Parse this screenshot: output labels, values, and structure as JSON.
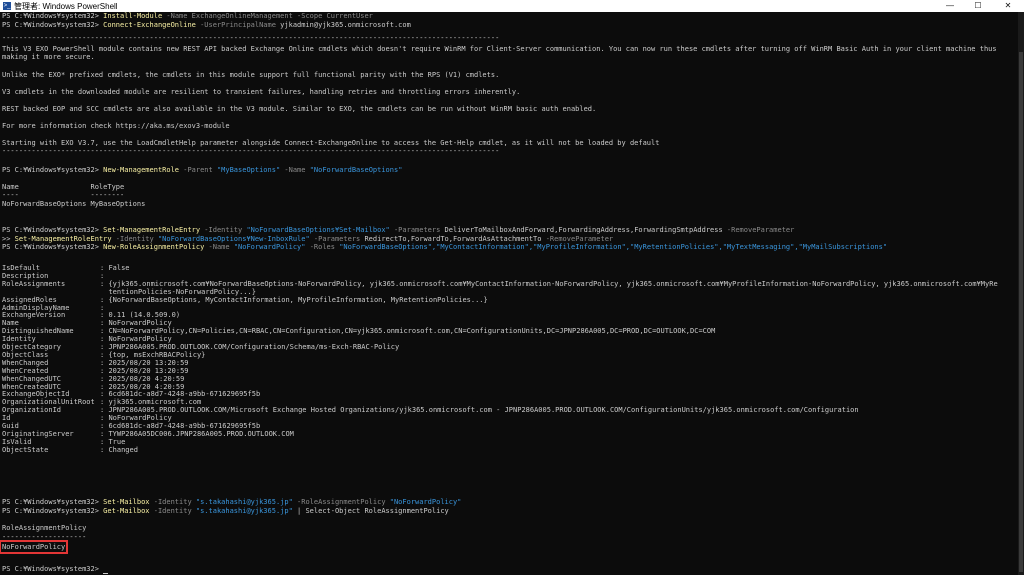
{
  "window": {
    "title": "管理者: Windows PowerShell",
    "app_icon": "powershell-icon",
    "controls": [
      "—",
      "☐",
      "✕"
    ]
  },
  "terminal": {
    "colors": {
      "background": "#0c0c0c",
      "text": "#cccccc",
      "cmdlet": "#f9f1a5",
      "parameter": "#8a8a8a",
      "string": "#3a96dd",
      "highlight": "#e23636"
    },
    "prompt": "PS C:¥Windows¥system32>",
    "cmd1": {
      "cmdlet": "Install-Module",
      "rest": " -Name ExchangeOnlineManagement -Scope CurrentUser"
    },
    "cmd2": {
      "cmdlet": "Connect-ExchangeOnline",
      "p1": " -UserPrincipalName ",
      "v1": "yjkadmin@yjk365.onmicrosoft.com"
    },
    "separator": "----------------------------------------------------------------------------------------------------------------------",
    "banner": [
      "This V3 EXO PowerShell module contains new REST API backed Exchange Online cmdlets which doesn't require WinRM for Client-Server communication. You can now run these cmdlets after turning off WinRM Basic Auth in your client machine thus",
      "making it more secure.",
      "Unlike the EXO* prefixed cmdlets, the cmdlets in this module support full functional parity with the RPS (V1) cmdlets.",
      "V3 cmdlets in the downloaded module are resilient to transient failures, handling retries and throttling errors inherently.",
      "REST backed EOP and SCC cmdlets are also available in the V3 module. Similar to EXO, the cmdlets can be run without WinRM basic auth enabled.",
      "For more information check https://aka.ms/exov3-module",
      "Starting with EXO V3.7, use the LoadCmdletHelp parameter alongside Connect-ExchangeOnline to access the Get-Help cmdlet, as it will not be loaded by default"
    ],
    "cmd3": {
      "cmdlet": "New-ManagementRole",
      "p1": " -Parent ",
      "v1": "\"MyBaseOptions\"",
      "p2": " -Name ",
      "v2": "\"NoForwardBaseOptions\""
    },
    "role_table": {
      "header": "Name                 RoleType",
      "underline": "----                 --------",
      "row": "NoForwardBaseOptions MyBaseOptions"
    },
    "cmd4": {
      "cmdlet": "Set-ManagementRoleEntry",
      "p1": " -Identity ",
      "v1": "\"NoForwardBaseOptions¥Set-Mailbox\"",
      "p2": " -Parameters ",
      "v2": "DeliverToMailboxAndForward,ForwardingAddress,ForwardingSmtpAddress",
      "p3": " -RemoveParameter"
    },
    "cmd4b": {
      "prefix": ">> ",
      "cmdlet": "Set-ManagementRoleEntry",
      "p1": " -Identity ",
      "v1": "\"NoForwardBaseOptions¥New-InboxRule\"",
      "p2": " -Parameters ",
      "v2": "RedirectTo,ForwardTo,ForwardAsAttachmentTo",
      "p3": " -RemoveParameter"
    },
    "cmd5": {
      "cmdlet": "New-RoleAssignmentPolicy",
      "p1": " -Name ",
      "v1": "\"NoForwardPolicy\"",
      "p2": " -Roles ",
      "v2": "\"NoForwardBaseOptions\",\"MyContactInformation\",\"MyProfileInformation\",\"MyRetentionPolicies\",\"MyTextMessaging\",\"MyMailSubscriptions\""
    },
    "properties": [
      {
        "k": "IsDefault",
        "v": "False"
      },
      {
        "k": "Description",
        "v": ""
      },
      {
        "k": "RoleAssignments",
        "v": "{yjk365.onmicrosoft.com¥NoForwardBaseOptions-NoForwardPolicy, yjk365.onmicrosoft.com¥MyContactInformation-NoForwardPolicy, yjk365.onmicrosoft.com¥MyProfileInformation-NoForwardPolicy, yjk365.onmicrosoft.com¥MyRe"
      },
      {
        "k": "",
        "v": "tentionPolicies-NoForwardPolicy...}",
        "cont": true
      },
      {
        "k": "AssignedRoles",
        "v": "{NoForwardBaseOptions, MyContactInformation, MyProfileInformation, MyRetentionPolicies...}"
      },
      {
        "k": "AdminDisplayName",
        "v": ""
      },
      {
        "k": "ExchangeVersion",
        "v": "0.11 (14.0.509.0)"
      },
      {
        "k": "Name",
        "v": "NoForwardPolicy"
      },
      {
        "k": "DistinguishedName",
        "v": "CN=NoForwardPolicy,CN=Policies,CN=RBAC,CN=Configuration,CN=yjk365.onmicrosoft.com,CN=ConfigurationUnits,DC=JPNP286A005,DC=PROD,DC=OUTLOOK,DC=COM"
      },
      {
        "k": "Identity",
        "v": "NoForwardPolicy"
      },
      {
        "k": "ObjectCategory",
        "v": "JPNP286A005.PROD.OUTLOOK.COM/Configuration/Schema/ms-Exch-RBAC-Policy"
      },
      {
        "k": "ObjectClass",
        "v": "{top, msExchRBACPolicy}"
      },
      {
        "k": "WhenChanged",
        "v": "2025/08/20 13:20:59"
      },
      {
        "k": "WhenCreated",
        "v": "2025/08/20 13:20:59"
      },
      {
        "k": "WhenChangedUTC",
        "v": "2025/08/20 4:20:59"
      },
      {
        "k": "WhenCreatedUTC",
        "v": "2025/08/20 4:20:59"
      },
      {
        "k": "ExchangeObjectId",
        "v": "6cd681dc-a8d7-4248-a9bb-671629695f5b"
      },
      {
        "k": "OrganizationalUnitRoot",
        "v": "yjk365.onmicrosoft.com"
      },
      {
        "k": "OrganizationId",
        "v": "JPNP286A005.PROD.OUTLOOK.COM/Microsoft Exchange Hosted Organizations/yjk365.onmicrosoft.com - JPNP286A005.PROD.OUTLOOK.COM/ConfigurationUnits/yjk365.onmicrosoft.com/Configuration"
      },
      {
        "k": "Id",
        "v": "NoForwardPolicy"
      },
      {
        "k": "Guid",
        "v": "6cd681dc-a8d7-4248-a9bb-671629695f5b"
      },
      {
        "k": "OriginatingServer",
        "v": "TYWP286A05DC006.JPNP286A005.PROD.OUTLOOK.COM"
      },
      {
        "k": "IsValid",
        "v": "True"
      },
      {
        "k": "ObjectState",
        "v": "Changed"
      }
    ],
    "cmd6": {
      "cmdlet": "Set-Mailbox",
      "p1": " -Identity ",
      "v1": "\"s.takahashi@yjk365.jp\"",
      "p2": " -RoleAssignmentPolicy ",
      "v2": "\"NoForwardPolicy\""
    },
    "cmd7": {
      "cmdlet": "Get-Mailbox",
      "p1": " -Identity ",
      "v1": "\"s.takahashi@yjk365.jp\"",
      "rest": " | Select-Object RoleAssignmentPolicy"
    },
    "result": {
      "header": "RoleAssignmentPolicy",
      "underline": "--------------------",
      "value": "NoForwardPolicy"
    }
  }
}
